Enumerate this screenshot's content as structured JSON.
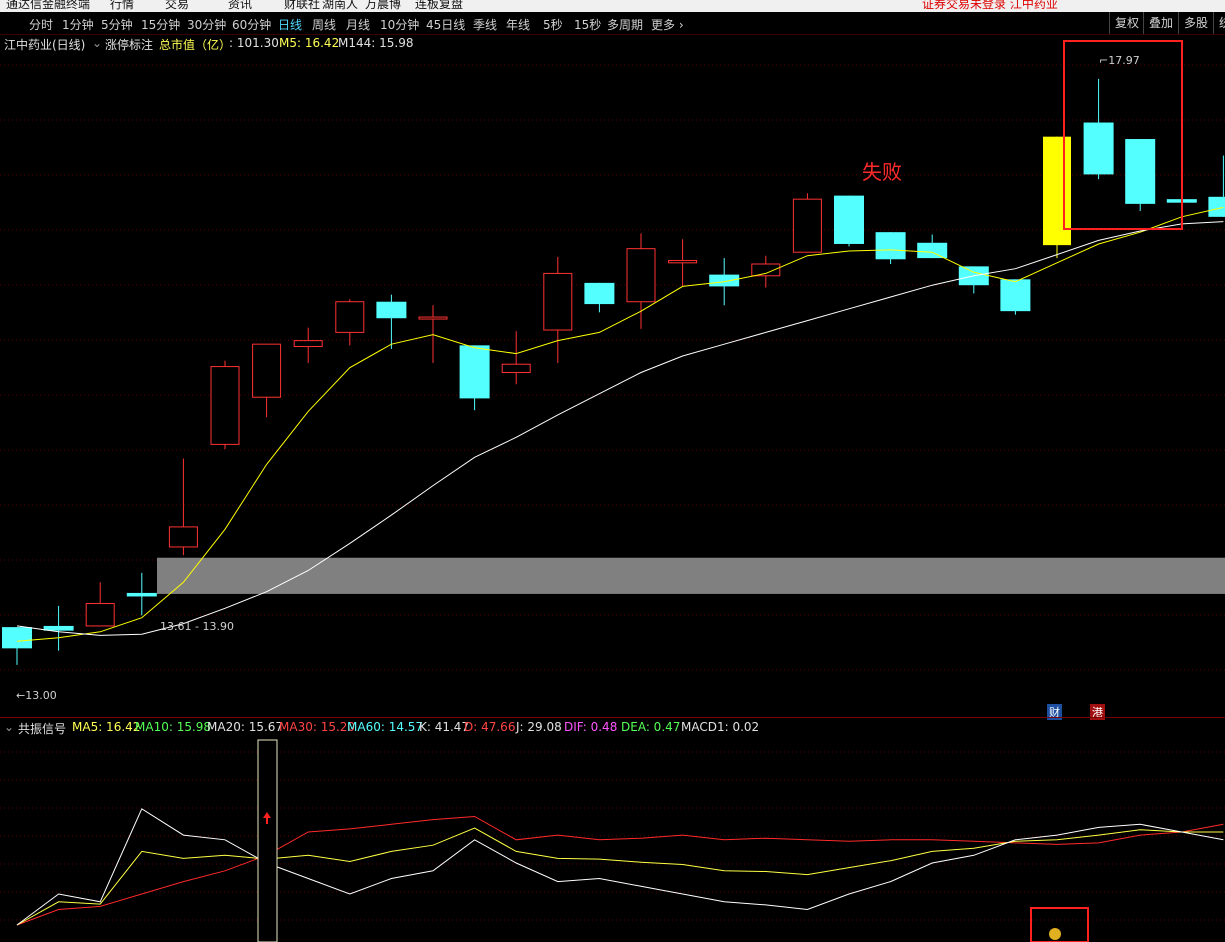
{
  "menubar": {
    "items": [
      "通达信金融终端",
      "行情",
      "交易",
      "资讯",
      "财联社",
      "湖南人",
      "万晨博",
      "连板复盘"
    ],
    "right_text": "证券交易未登录  江中药业"
  },
  "periods": [
    "分时",
    "1分钟",
    "5分钟",
    "15分钟",
    "30分钟",
    "60分钟",
    "日线",
    "周线",
    "月线",
    "10分钟",
    "45日线",
    "季线",
    "年线",
    "5秒",
    "15秒",
    "多周期",
    "更多 ›"
  ],
  "active_period": "日线",
  "right_buttons": [
    "复权",
    "叠加",
    "多股",
    "统"
  ],
  "info": {
    "stock": "江中药业(日线)",
    "indicator": "涨停标注",
    "mcap_label": "总市值（亿）",
    "mcap_value": ": 101.30",
    "ma5": "M5: 16.42",
    "ma144": "M144: 15.98"
  },
  "annotation_fail": "失败",
  "price_labels": {
    "high": "17.97",
    "low": "13.00",
    "zone": "13.61 - 13.90"
  },
  "event_marks": {
    "fin": "财",
    "hk": "港"
  },
  "sub": {
    "name": "共振信号",
    "values": [
      {
        "text": "MA5: 16.42",
        "color": "#ffff55"
      },
      {
        "text": "MA10: 15.98",
        "color": "#55ff55"
      },
      {
        "text": "MA20: 15.67",
        "color": "#e0e0e0"
      },
      {
        "text": "MA30: 15.20",
        "color": "#ff4444"
      },
      {
        "text": "MA60: 14.57",
        "color": "#55ffff"
      },
      {
        "text": "K: 41.47",
        "color": "#e0e0e0"
      },
      {
        "text": "D: 47.66",
        "color": "#ff4444"
      },
      {
        "text": "J: 29.08",
        "color": "#e0e0e0"
      },
      {
        "text": "DIF: 0.48",
        "color": "#ff55ff"
      },
      {
        "text": "DEA: 0.47",
        "color": "#55ff55"
      },
      {
        "text": "MACD1: 0.02",
        "color": "#e0e0e0"
      }
    ]
  },
  "chart_data": {
    "type": "candlestick",
    "price_range": [
      12.6,
      18.3
    ],
    "candles": [
      {
        "o": 13.32,
        "h": 13.32,
        "l": 13.0,
        "c": 13.14
      },
      {
        "o": 13.33,
        "h": 13.5,
        "l": 13.12,
        "c": 13.29
      },
      {
        "o": 13.33,
        "h": 13.7,
        "l": 13.33,
        "c": 13.52
      },
      {
        "o": 13.61,
        "h": 13.78,
        "l": 13.42,
        "c": 13.58
      },
      {
        "o": 14.0,
        "h": 14.75,
        "l": 13.93,
        "c": 14.17
      },
      {
        "o": 14.87,
        "h": 15.58,
        "l": 14.83,
        "c": 15.53
      },
      {
        "o": 15.27,
        "h": 15.65,
        "l": 15.1,
        "c": 15.72
      },
      {
        "o": 15.7,
        "h": 15.86,
        "l": 15.56,
        "c": 15.75
      },
      {
        "o": 15.82,
        "h": 16.1,
        "l": 15.71,
        "c": 16.08
      },
      {
        "o": 16.08,
        "h": 16.14,
        "l": 15.68,
        "c": 15.94
      },
      {
        "o": 15.95,
        "h": 16.05,
        "l": 15.56,
        "c": 15.95
      },
      {
        "o": 15.71,
        "h": 15.71,
        "l": 15.16,
        "c": 15.26
      },
      {
        "o": 15.48,
        "h": 15.83,
        "l": 15.38,
        "c": 15.55
      },
      {
        "o": 15.84,
        "h": 16.46,
        "l": 15.56,
        "c": 16.32
      },
      {
        "o": 16.24,
        "h": 16.24,
        "l": 15.99,
        "c": 16.06
      },
      {
        "o": 16.08,
        "h": 16.66,
        "l": 15.85,
        "c": 16.53
      },
      {
        "o": 16.41,
        "h": 16.61,
        "l": 16.21,
        "c": 16.43
      },
      {
        "o": 16.31,
        "h": 16.45,
        "l": 16.05,
        "c": 16.21
      },
      {
        "o": 16.3,
        "h": 16.47,
        "l": 16.2,
        "c": 16.4
      },
      {
        "o": 16.5,
        "h": 17.0,
        "l": 16.5,
        "c": 16.95
      },
      {
        "o": 16.98,
        "h": 16.98,
        "l": 16.55,
        "c": 16.57
      },
      {
        "o": 16.67,
        "h": 16.67,
        "l": 16.4,
        "c": 16.44
      },
      {
        "o": 16.58,
        "h": 16.65,
        "l": 16.46,
        "c": 16.45
      },
      {
        "o": 16.38,
        "h": 16.38,
        "l": 16.15,
        "c": 16.22
      },
      {
        "o": 16.27,
        "h": 16.27,
        "l": 15.97,
        "c": 16.0
      },
      {
        "o": 16.56,
        "h": 16.49,
        "l": 16.45,
        "c": 17.48
      },
      {
        "o": 17.6,
        "h": 17.97,
        "l": 17.12,
        "c": 17.16
      },
      {
        "o": 17.46,
        "h": 17.46,
        "l": 16.85,
        "c": 16.91
      },
      {
        "o": 16.95,
        "h": 17.21,
        "l": 16.75,
        "c": 16.92
      },
      {
        "o": 16.97,
        "h": 17.32,
        "l": 16.88,
        "c": 16.8
      }
    ],
    "ma5": [
      13.2,
      13.23,
      13.28,
      13.4,
      13.7,
      14.15,
      14.7,
      15.15,
      15.52,
      15.72,
      15.8,
      15.69,
      15.64,
      15.75,
      15.82,
      16.0,
      16.21,
      16.25,
      16.32,
      16.47,
      16.51,
      16.52,
      16.5,
      16.33,
      16.25,
      16.41,
      16.57,
      16.67,
      16.8,
      16.88
    ],
    "ma144": [
      13.33,
      13.28,
      13.25,
      13.26,
      13.35,
      13.48,
      13.62,
      13.8,
      14.03,
      14.27,
      14.52,
      14.76,
      14.93,
      15.12,
      15.3,
      15.48,
      15.62,
      15.72,
      15.82,
      15.92,
      16.02,
      16.12,
      16.22,
      16.3,
      16.36,
      16.48,
      16.6,
      16.68,
      16.74,
      16.76
    ],
    "sub_k": [
      0,
      20,
      15,
      75,
      58,
      55,
      40,
      30,
      20,
      30,
      35,
      55,
      40,
      28,
      30,
      25,
      20,
      15,
      13,
      10,
      20,
      28,
      40,
      45,
      55,
      58,
      63,
      65,
      60,
      55
    ],
    "sub_d": [
      0,
      10,
      12,
      20,
      28,
      35,
      45,
      60,
      62,
      65,
      68,
      70,
      55,
      58,
      55,
      56,
      58,
      55,
      56,
      55,
      54,
      55,
      55,
      54,
      53,
      52,
      53,
      58,
      60,
      65
    ]
  },
  "colors": {
    "up": "#ff3232",
    "down": "#54ffff",
    "ma5": "#ffff00",
    "ma144": "#ffffff",
    "limit_up": "#ffff00",
    "zone": "#808080"
  }
}
